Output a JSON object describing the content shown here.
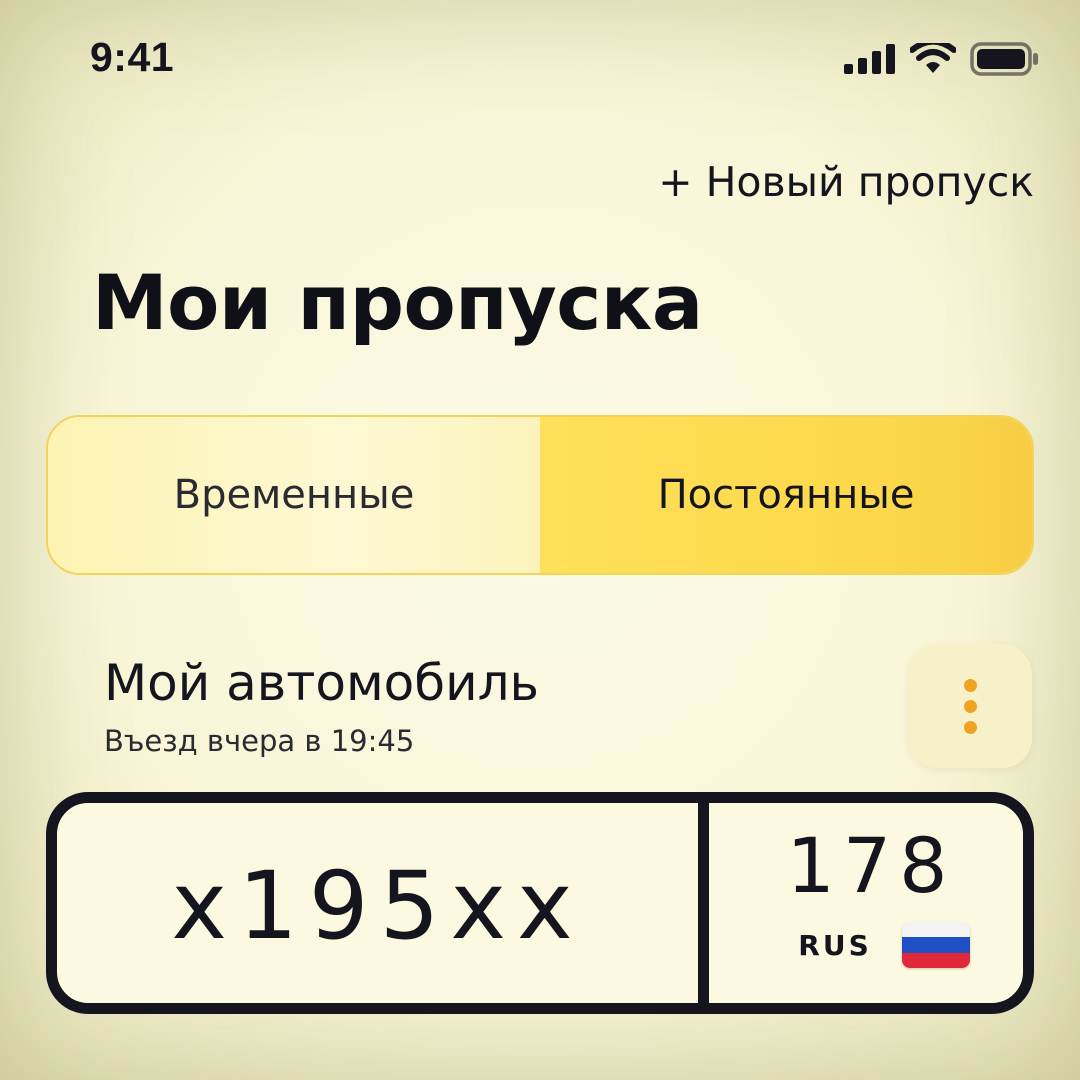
{
  "status_bar": {
    "time": "9:41",
    "icons": [
      "cellular-signal-icon",
      "wifi-icon",
      "battery-icon"
    ]
  },
  "header": {
    "new_pass_label": "+ Новый пропуск",
    "title": "Мои пропуска"
  },
  "tabs": [
    {
      "label": "Временные",
      "selected": false
    },
    {
      "label": "Постоянные",
      "selected": true
    }
  ],
  "car": {
    "title": "Мой автомобиль",
    "subtitle": "Въезд вчера в 19:45",
    "menu_icon": "more-vertical-icon"
  },
  "plate": {
    "number": "x195xx",
    "region_code": "178",
    "country": "RUS",
    "flag_icon": "russian-flag-icon"
  },
  "colors": {
    "accent_yellow": "#fcd84a",
    "pale_yellow": "#fdf6c2",
    "dot_orange": "#f0a323",
    "text_dark": "#15151f",
    "flag_white": "#f4f4f4",
    "flag_blue": "#1f4fc4",
    "flag_red": "#e0283a"
  }
}
